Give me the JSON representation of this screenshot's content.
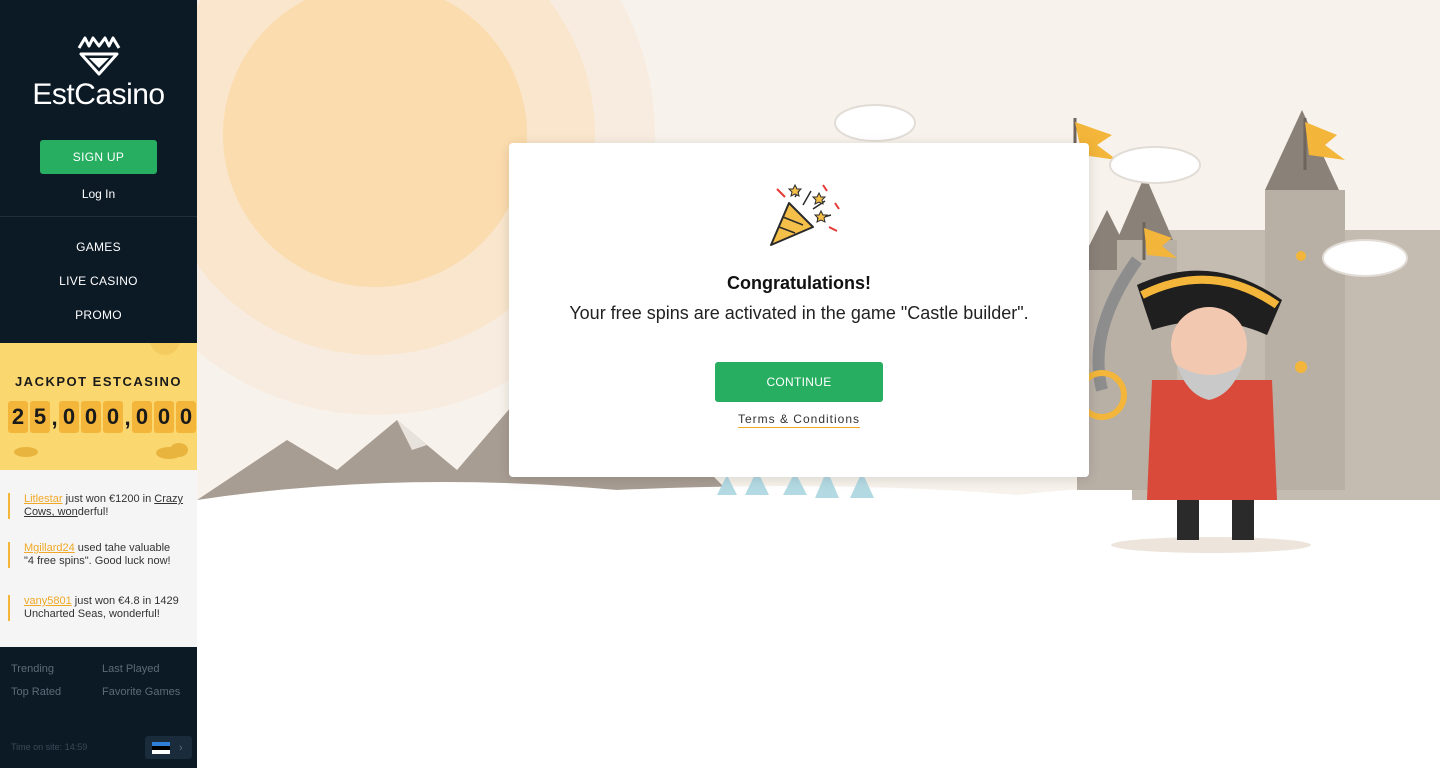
{
  "brand": {
    "name": "EstCasino"
  },
  "auth": {
    "signup_label": "SIGN UP",
    "login_label": "Log In"
  },
  "nav": {
    "items": [
      {
        "label": "GAMES"
      },
      {
        "label": "LIVE CASINO"
      },
      {
        "label": "PROMO"
      }
    ]
  },
  "jackpot": {
    "title": "JACKPOT ESTCASINO",
    "digits": [
      "2",
      "5",
      "0",
      "0",
      "0",
      "0",
      "0",
      "0"
    ],
    "currency": "$"
  },
  "feed": {
    "items": [
      {
        "user": "Litlestar",
        "text_before": " just won €1200 in ",
        "game": "Crazy Cows, won",
        "text_after": "derful!"
      },
      {
        "user": "Mgillard24",
        "text": " used tahe valuable \"4 free spins\". Good luck now!"
      },
      {
        "user": "vany5801",
        "text": " just won €4.8 in 1429 Uncharted Seas, wonderful!"
      }
    ]
  },
  "bottom_links": {
    "trending": "Trending",
    "last_played": "Last Played",
    "top_rated": "Top Rated",
    "favorite_games": "Favorite Games"
  },
  "time_on_site": "Time on site: 14:59",
  "language": {
    "flag": "estonia-flag-icon"
  },
  "modal": {
    "icon": "party-popper-icon",
    "title": "Congratulations!",
    "message": "Your free spins are activated in the game \"Castle builder\".",
    "continue_label": "CONTINUE",
    "terms_label": "Terms & Conditions"
  },
  "colors": {
    "sidebar_bg": "#0c1a26",
    "accent_green": "#27ae60",
    "jackpot_yellow": "#fbd770",
    "gold": "#f0a826"
  }
}
